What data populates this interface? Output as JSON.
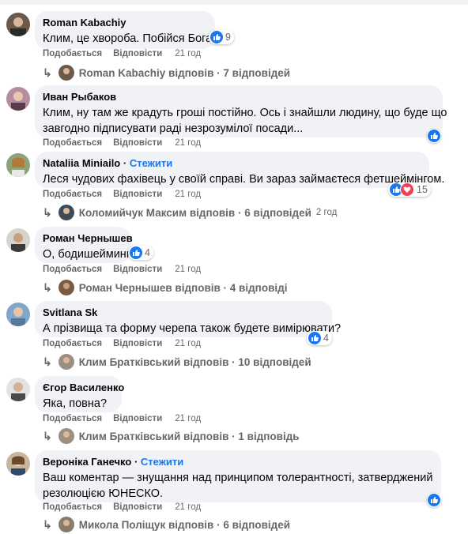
{
  "labels": {
    "like": "Подобається",
    "reply": "Відповісти"
  },
  "comments": [
    {
      "name": "Roman Kabachiy",
      "text": [
        "Клим, це хвороба. Побійся Бога."
      ],
      "reactions": "9",
      "time": "21 год",
      "replies": {
        "text": "Roman Kabachiy відповів · 7 відповідей",
        "time": ""
      }
    },
    {
      "name": "Иван Рыбаков",
      "text": [
        "Клим, ну там же крадуть гроші постійно. Ось і знайшли людину, що буде що",
        "завгодно підписувати раді незрозумілої посади..."
      ],
      "reactions": "",
      "time": "21 год"
    },
    {
      "name": "Nataliia Miniailo",
      "follow": "Стежити",
      "text": [
        "Леся чудових фахівець у своїй справі. Ви зараз займаєтеся фетшеймінгом."
      ],
      "reactions": "15",
      "time": "21 год",
      "replies": {
        "text": "Коломийчук Максим відповів · 6 відповідей",
        "time": "2 год"
      }
    },
    {
      "name": "Роман Чернышев",
      "text": [
        "О, бодишейминг"
      ],
      "reactions": "4",
      "time": "21 год",
      "replies": {
        "text": "Роман Чернышев відповів · 4 відповіді",
        "time": ""
      }
    },
    {
      "name": "Svitlana Sk",
      "text": [
        "А прізвища та форму черепа також будете вимірювати?"
      ],
      "reactions": "4",
      "time": "21 год",
      "replies": {
        "text": "Клим Братківський відповів · 10 відповідей",
        "time": ""
      }
    },
    {
      "name": "Єгор Василенко",
      "text": [
        "Яка, повна?"
      ],
      "reactions": "",
      "time": "21 год",
      "replies": {
        "text": "Клим Братківський відповів · 1 відповідь",
        "time": ""
      }
    },
    {
      "name": "Вероніка Ганечко",
      "follow": "Стежити",
      "text": [
        "Ваш коментар — знущання над принципом толерантності, затверджений",
        "резолюцією ЮНЕСКО."
      ],
      "reactions": "",
      "time": "21 год",
      "replies": {
        "text": "Микола Поліщук відповів · 6 відповідей",
        "time": ""
      }
    }
  ],
  "colors": {
    "bubble": "#f0f2f5",
    "like": "#1877f2",
    "love": "#f33e58",
    "meta": "#65676b"
  }
}
